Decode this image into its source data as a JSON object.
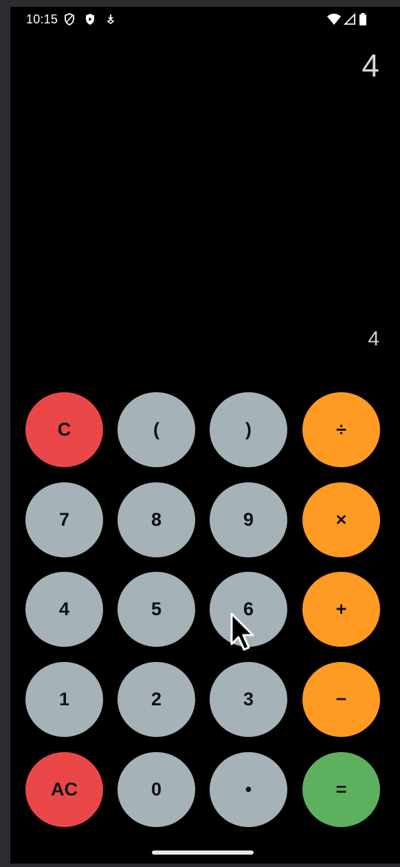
{
  "status_bar": {
    "time": "10:15",
    "icons_left": [
      "shield-outline-icon",
      "shield-play-icon",
      "download-icon"
    ],
    "icons_right": [
      "wifi-icon",
      "cellular-signal-icon",
      "battery-icon"
    ]
  },
  "display": {
    "expression": "4",
    "result": "4"
  },
  "keypad": {
    "rows": [
      [
        {
          "label": "C",
          "kind": "red"
        },
        {
          "label": "(",
          "kind": "gray"
        },
        {
          "label": ")",
          "kind": "gray"
        },
        {
          "label": "÷",
          "kind": "orange"
        }
      ],
      [
        {
          "label": "7",
          "kind": "gray"
        },
        {
          "label": "8",
          "kind": "gray"
        },
        {
          "label": "9",
          "kind": "gray"
        },
        {
          "label": "×",
          "kind": "orange"
        }
      ],
      [
        {
          "label": "4",
          "kind": "gray"
        },
        {
          "label": "5",
          "kind": "gray"
        },
        {
          "label": "6",
          "kind": "gray"
        },
        {
          "label": "+",
          "kind": "orange"
        }
      ],
      [
        {
          "label": "1",
          "kind": "gray"
        },
        {
          "label": "2",
          "kind": "gray"
        },
        {
          "label": "3",
          "kind": "gray"
        },
        {
          "label": "−",
          "kind": "orange"
        }
      ],
      [
        {
          "label": "AC",
          "kind": "red"
        },
        {
          "label": "0",
          "kind": "gray"
        },
        {
          "label": "•",
          "kind": "gray"
        },
        {
          "label": "=",
          "kind": "green"
        }
      ]
    ]
  },
  "colors": {
    "background": "#000000",
    "number_key": "#a5b2b8",
    "clear_key": "#ea4748",
    "operator_key": "#ff9a22",
    "equals_key": "#5cb05e"
  }
}
